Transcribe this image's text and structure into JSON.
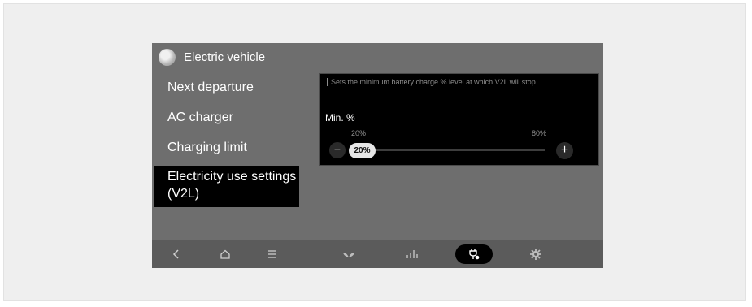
{
  "app": {
    "title": "Electric vehicle",
    "icon": "electric-vehicle-icon"
  },
  "menu": {
    "items": [
      {
        "label": "Next departure",
        "active": false
      },
      {
        "label": "AC charger",
        "active": false
      },
      {
        "label": "Charging limit",
        "active": false
      },
      {
        "label": "Electricity use settings (V2L)",
        "active": true
      }
    ]
  },
  "panel": {
    "description": "Sets the minimum battery charge % level at which V2L will stop.",
    "label": "Min. %",
    "slider": {
      "min_label": "20%",
      "max_label": "80%",
      "value_label": "20%",
      "value": 20,
      "min": 20,
      "max": 80
    },
    "minus_label": "−",
    "plus_label": "+"
  },
  "bottom_bar": {
    "icons": [
      "back-icon",
      "home-icon",
      "menu-icon",
      "eco-leaf-icon",
      "energy-bars-icon",
      "v2l-plug-icon",
      "gear-icon"
    ],
    "active_icon": "v2l-plug-icon"
  },
  "colors": {
    "screen_bg": "#6e6e6e",
    "panel_bg": "#000000",
    "active_bg": "#000000"
  }
}
